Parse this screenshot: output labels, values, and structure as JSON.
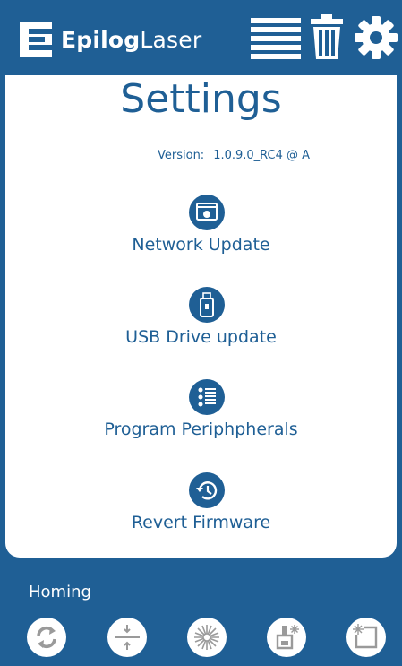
{
  "header": {
    "logo_bold": "Epilog",
    "logo_light": "Laser",
    "icons": [
      "list-icon",
      "trash-icon",
      "gear-icon"
    ]
  },
  "page": {
    "title": "Settings",
    "version_label": "Version:",
    "version_value": "1.0.9.0_RC4 @ A"
  },
  "actions": [
    {
      "label": "Network Update",
      "icon": "network-update-icon"
    },
    {
      "label": "USB Drive update",
      "icon": "usb-drive-icon"
    },
    {
      "label": "Program Periphpherals",
      "icon": "peripherals-list-icon"
    },
    {
      "label": "Revert Firmware",
      "icon": "revert-history-icon"
    }
  ],
  "homing": {
    "label": "Homing",
    "buttons": [
      "refresh-home-icon",
      "center-cross-icon",
      "laser-burst-icon",
      "focus-laser-icon",
      "corner-laser-icon"
    ]
  },
  "colors": {
    "brand_blue": "#1f5f95",
    "background": "#ffffff",
    "icon_gray": "#9a9a9a"
  }
}
